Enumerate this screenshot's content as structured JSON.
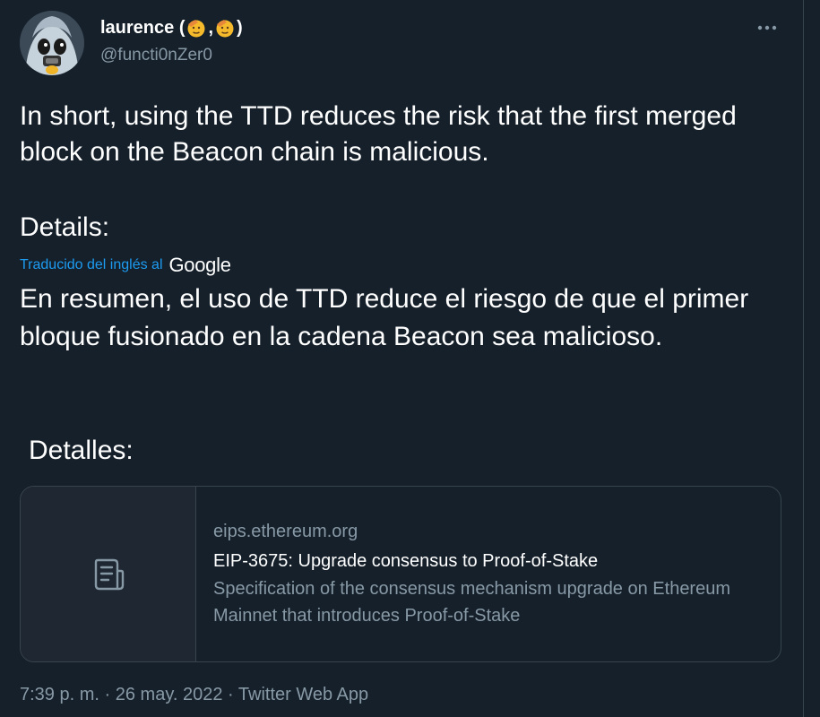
{
  "author": {
    "name": "laurence (",
    "name_sep": ", ",
    "name_end": ")",
    "name_emojis": [
      "saluting-face-emoji",
      "saluting-face-emoji"
    ],
    "handle": "@functi0nZer0"
  },
  "tweet": {
    "text": "In short, using the TTD reduces the risk that the first merged block on the Beacon chain is malicious.",
    "details": "Details:",
    "translation_note": "Traducido del inglés al",
    "translation_provider": "Google",
    "translated_text": "En resumen, el uso de TTD reduce el riesgo de que el primer bloque fusionado en la cadena Beacon sea malicioso.",
    "translated_details": "Detalles:"
  },
  "link_card": {
    "domain": "eips.ethereum.org",
    "title": "EIP-3675: Upgrade consensus to Proof-of-Stake",
    "description": "Specification of the consensus mechanism upgrade on Ethereum Mainnet that introduces Proof-of-Stake",
    "icon": "document-icon"
  },
  "meta": {
    "time": "7:39 p. m.",
    "separator": "·",
    "date": "26 may. 2022",
    "source": "Twitter Web App"
  },
  "colors": {
    "background": "#15202b",
    "text_primary": "#ffffff",
    "text_secondary": "#8899a6",
    "link": "#1d9bf0",
    "border": "#38444d"
  }
}
